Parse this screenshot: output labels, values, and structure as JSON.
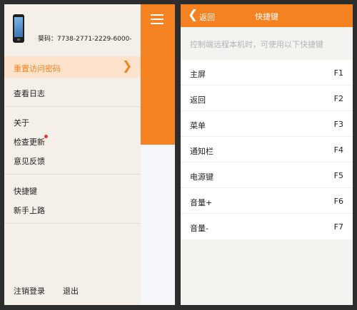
{
  "colors": {
    "accent": "#f58220",
    "active_row_bg": "#fde3cc",
    "update_dot": "#e53935"
  },
  "left_screen": {
    "header": {
      "device_icon": "phone-icon",
      "registration_code": "葵码：7738-2771-2229-6000-"
    },
    "highlighted_item": {
      "label": "重置访问密码",
      "icon": "chevron-right-icon"
    },
    "menu": {
      "view_log": "查看日志",
      "about": "关于",
      "check_update": "检查更新",
      "feedback": "意见反馈",
      "shortcuts": "快捷键",
      "beginner_guide": "新手上路"
    },
    "footer": {
      "logout": "注销登录",
      "exit": "退出"
    },
    "toolbar_icon": "menu-icon"
  },
  "right_screen": {
    "topbar": {
      "back_label": "返回",
      "back_icon": "chevron-left-icon",
      "title": "快捷键"
    },
    "hint": "控制端远程本机时，可使用以下快捷键",
    "shortcuts": [
      {
        "name": "主屏",
        "key": "F1"
      },
      {
        "name": "返回",
        "key": "F2"
      },
      {
        "name": "菜单",
        "key": "F3"
      },
      {
        "name": "通知栏",
        "key": "F4"
      },
      {
        "name": "电源键",
        "key": "F5"
      },
      {
        "name": "音量+",
        "key": "F6"
      },
      {
        "name": "音量-",
        "key": "F7"
      }
    ]
  }
}
